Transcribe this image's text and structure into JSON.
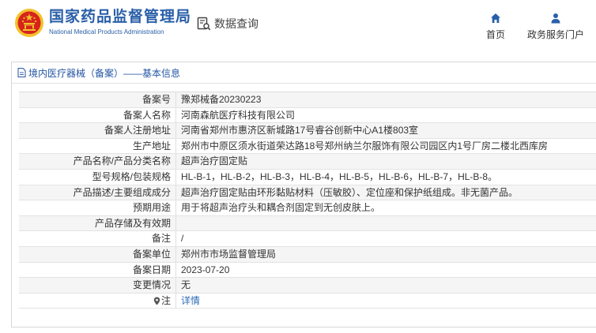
{
  "header": {
    "brand_cn": "国家药品监督管理局",
    "brand_en": "National Medical Products Administration",
    "query_label": "数据查询",
    "nav": {
      "home_label": "首页",
      "gov_label": "政务服务门户"
    }
  },
  "panel": {
    "title": "境内医疗器械（备案）——基本信息"
  },
  "rows": [
    {
      "label": "备案号",
      "value": "豫郑械备20230223"
    },
    {
      "label": "备案人名称",
      "value": "河南森航医疗科技有限公司"
    },
    {
      "label": "备案人注册地址",
      "value": "河南省郑州市惠济区新城路17号睿谷创新中心A1楼803室"
    },
    {
      "label": "生产地址",
      "value": "郑州市中原区须水街道荣达路18号郑州纳兰尔服饰有限公司园区内1号厂房二楼北西库房"
    },
    {
      "label": "产品名称/产品分类名称",
      "value": "超声治疗固定贴"
    },
    {
      "label": "型号规格/包装规格",
      "value": "HL-B-1，HL-B-2，HL-B-3，HL-B-4，HL-B-5，HL-B-6，HL-B-7，HL-B-8。"
    },
    {
      "label": "产品描述/主要组成成分",
      "value": "超声治疗固定贴由环形黏贴材料（压敏胶）、定位座和保护纸组成。非无菌产品。"
    },
    {
      "label": "预期用途",
      "value": "用于将超声治疗头和耦合剂固定到无创皮肤上。"
    },
    {
      "label": "产品存储及有效期",
      "value": ""
    },
    {
      "label": "备注",
      "value": "/"
    },
    {
      "label": "备案单位",
      "value": "郑州市市场监督管理局"
    },
    {
      "label": "备案日期",
      "value": "2023-07-20"
    },
    {
      "label": "变更情况",
      "value": "无"
    },
    {
      "label": "注",
      "value": "详情"
    }
  ],
  "colors": {
    "brand_blue": "#2a5fa8",
    "link_blue": "#2c6ab8",
    "emblem_red": "#d6241b",
    "emblem_gold": "#f3c12d"
  }
}
